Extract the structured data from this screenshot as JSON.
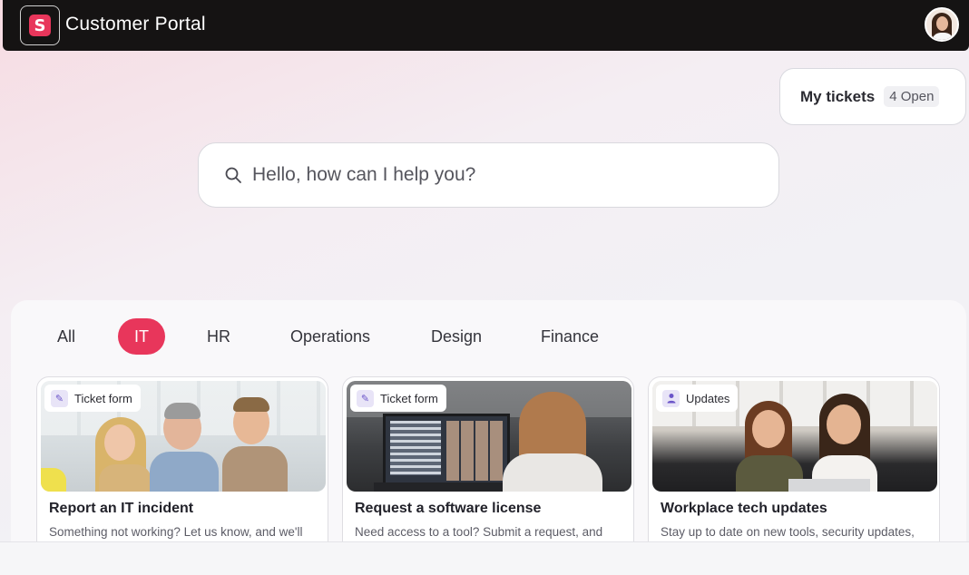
{
  "header": {
    "title": "Customer Portal",
    "logo_letter": "S"
  },
  "tickets": {
    "label": "My tickets",
    "badge": "4 Open"
  },
  "search": {
    "placeholder": "Hello, how can I help you?"
  },
  "tabs": [
    {
      "label": "All",
      "active": false
    },
    {
      "label": "IT",
      "active": true
    },
    {
      "label": "HR",
      "active": false
    },
    {
      "label": "Operations",
      "active": false
    },
    {
      "label": "Design",
      "active": false
    },
    {
      "label": "Finance",
      "active": false
    }
  ],
  "cards": [
    {
      "badge": "Ticket form",
      "badge_icon": "form-icon",
      "title": "Report an IT incident",
      "desc": "Something not working? Let us know, and we'll"
    },
    {
      "badge": "Ticket form",
      "badge_icon": "form-icon",
      "title": "Request a software license",
      "desc": "Need access to a tool? Submit a request, and"
    },
    {
      "badge": "Updates",
      "badge_icon": "person-icon",
      "title": "Workplace tech updates",
      "desc": "Stay up to date on new tools, security updates,"
    }
  ],
  "colors": {
    "accent": "#e8365b",
    "topbar": "#151313"
  }
}
